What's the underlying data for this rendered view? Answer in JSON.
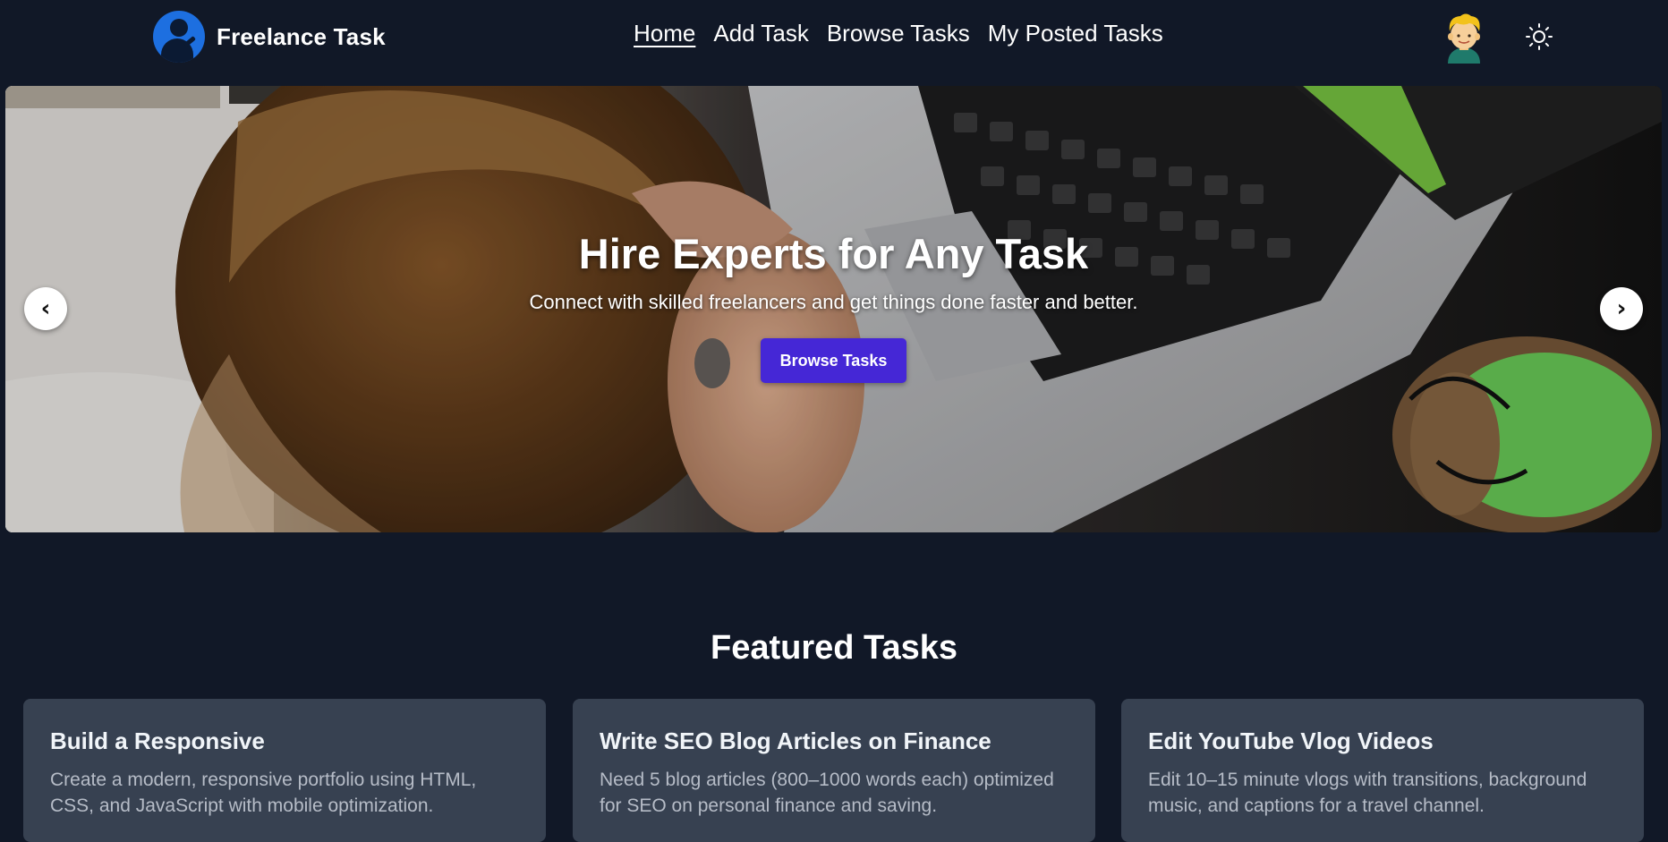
{
  "navbar": {
    "brand": "Freelance Task",
    "links": [
      "Home",
      "Add Task",
      "Browse Tasks",
      "My Posted Tasks"
    ],
    "active_link": "Home",
    "avatar_icon": "user-avatar-icon",
    "theme_icon": "sun-icon"
  },
  "hero": {
    "title": "Hire Experts for Any Task",
    "subtitle": "Connect with skilled freelancers and get things done faster and better.",
    "cta": "Browse Tasks",
    "prev_label": "‹",
    "next_label": "›"
  },
  "featured": {
    "title": "Featured Tasks",
    "tasks": [
      {
        "title": "Build a Responsive",
        "description": "Create a modern, responsive portfolio using HTML, CSS, and JavaScript with mobile optimization."
      },
      {
        "title": "Write SEO Blog Articles on Finance",
        "description": "Need 5 blog articles (800–1000 words each) optimized for SEO on personal finance and saving."
      },
      {
        "title": "Edit YouTube Vlog Videos",
        "description": "Edit 10–15 minute vlogs with transitions, background music, and captions for a travel channel."
      }
    ]
  },
  "colors": {
    "background": "#111827",
    "card": "#374151",
    "accent": "#4527d6",
    "logo": "#1d6fe0"
  }
}
